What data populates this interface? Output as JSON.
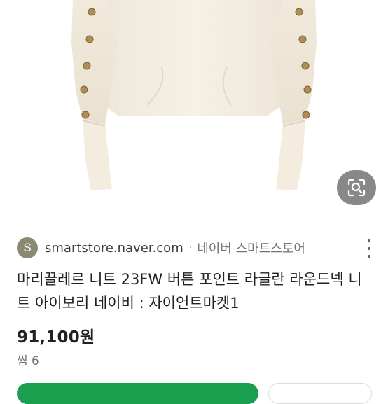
{
  "result": {
    "favicon_letter": "S",
    "domain": "smartstore.naver.com",
    "separator": "·",
    "site_name": "네이버 스마트스토어",
    "title": "마리끌레르 니트 23FW 버튼 포인트 라글란 라운드넥 니트 아이보리 네이비 : 자이언트마켓1",
    "price": "91,100원",
    "likes": "찜 6"
  },
  "icons": {
    "image_search": "lens-search-icon",
    "more": "more-vert-icon"
  },
  "colors": {
    "sweater": "#f3ede0",
    "button_brass": "#b08d55",
    "primary_button": "#1a9f4f"
  }
}
